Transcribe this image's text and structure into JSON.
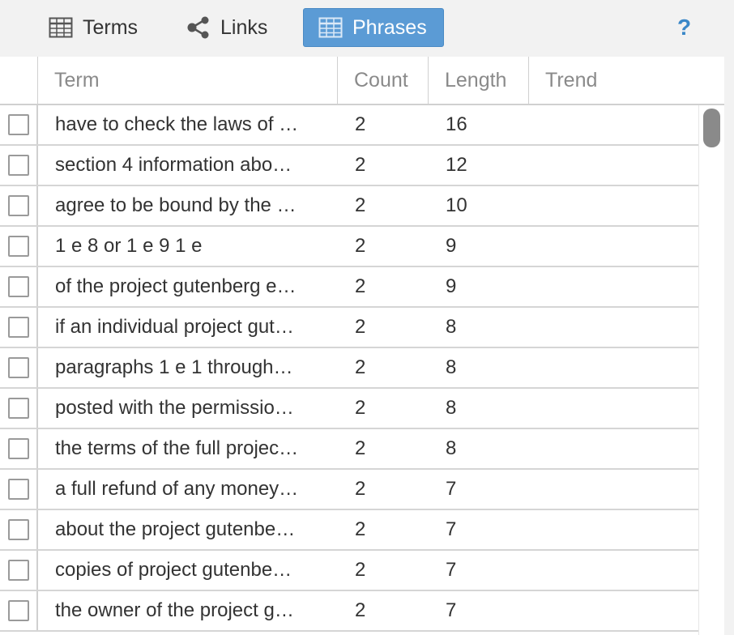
{
  "toolbar": {
    "tabs": [
      {
        "label": "Terms",
        "icon": "table-icon",
        "active": false
      },
      {
        "label": "Links",
        "icon": "share-icon",
        "active": false
      },
      {
        "label": "Phrases",
        "icon": "table-icon",
        "active": true
      }
    ],
    "help_label": "?",
    "accent_color": "#5b9bd5"
  },
  "grid": {
    "columns": [
      "Term",
      "Count",
      "Length",
      "Trend"
    ],
    "rows": [
      {
        "term": "have to check the laws of …",
        "count": "2",
        "length": "16"
      },
      {
        "term": "section 4 information abo…",
        "count": "2",
        "length": "12"
      },
      {
        "term": "agree to be bound by the …",
        "count": "2",
        "length": "10"
      },
      {
        "term": "1 e 8 or 1 e 9 1 e",
        "count": "2",
        "length": "9"
      },
      {
        "term": "of the project gutenberg e…",
        "count": "2",
        "length": "9"
      },
      {
        "term": "if an individual project gut…",
        "count": "2",
        "length": "8"
      },
      {
        "term": "paragraphs 1 e 1 through…",
        "count": "2",
        "length": "8"
      },
      {
        "term": "posted with the permissio…",
        "count": "2",
        "length": "8"
      },
      {
        "term": "the terms of the full projec…",
        "count": "2",
        "length": "8"
      },
      {
        "term": "a full refund of any money…",
        "count": "2",
        "length": "7"
      },
      {
        "term": "about the project gutenbe…",
        "count": "2",
        "length": "7"
      },
      {
        "term": "copies of project gutenbe…",
        "count": "2",
        "length": "7"
      },
      {
        "term": "the owner of the project g…",
        "count": "2",
        "length": "7"
      }
    ]
  }
}
